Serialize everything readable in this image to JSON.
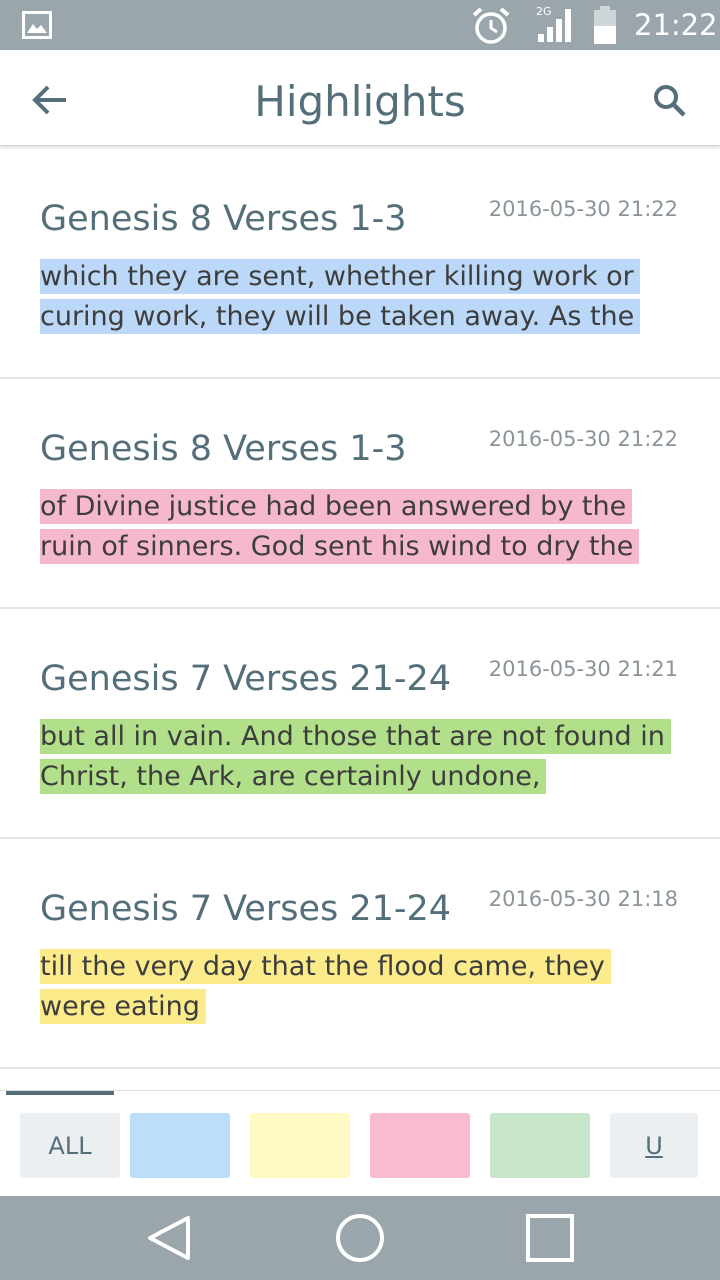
{
  "status_bar": {
    "time": "21:22",
    "network_label": "2G",
    "icons": [
      "image-icon",
      "alarm-icon",
      "signal-icon",
      "battery-icon"
    ]
  },
  "app_bar": {
    "title": "Highlights",
    "back_icon": "arrow-left-icon",
    "search_icon": "search-icon"
  },
  "highlights": [
    {
      "reference": "Genesis 8 Verses 1-3",
      "date": "2016-05-30 21:22",
      "text": "which they are sent, whether killing work or curing work, they will be taken away. As the",
      "color": "#bcd8f8"
    },
    {
      "reference": "Genesis 8 Verses 1-3",
      "date": "2016-05-30 21:22",
      "text": "of Divine justice had been answered by the ruin of sinners. God sent his wind to dry the",
      "color": "#f6b8cf"
    },
    {
      "reference": "Genesis 7 Verses 21-24",
      "date": "2016-05-30 21:21",
      "text": "but all in vain. And those that are not found in Christ, the Ark, are certainly undone,",
      "color": "#b2e08a"
    },
    {
      "reference": "Genesis 7 Verses 21-24",
      "date": "2016-05-30 21:18",
      "text": "till the very day that the flood came, they were eating",
      "color": "#fbeb8a"
    }
  ],
  "filters": [
    {
      "label": "ALL",
      "color": "#eceff1"
    },
    {
      "label": "",
      "color": "#bbdefb"
    },
    {
      "label": "",
      "color": "#fff9c4"
    },
    {
      "label": "",
      "color": "#f8bbd0"
    },
    {
      "label": "",
      "color": "#c8e6c9"
    },
    {
      "label": "U",
      "color": "#eceff1"
    }
  ],
  "nav_bar": {
    "icons": [
      "back-triangle-icon",
      "home-circle-icon",
      "recents-square-icon"
    ]
  },
  "theme": {
    "status_bar_bg": "#9aa6ac",
    "accent": "#546e7a"
  }
}
